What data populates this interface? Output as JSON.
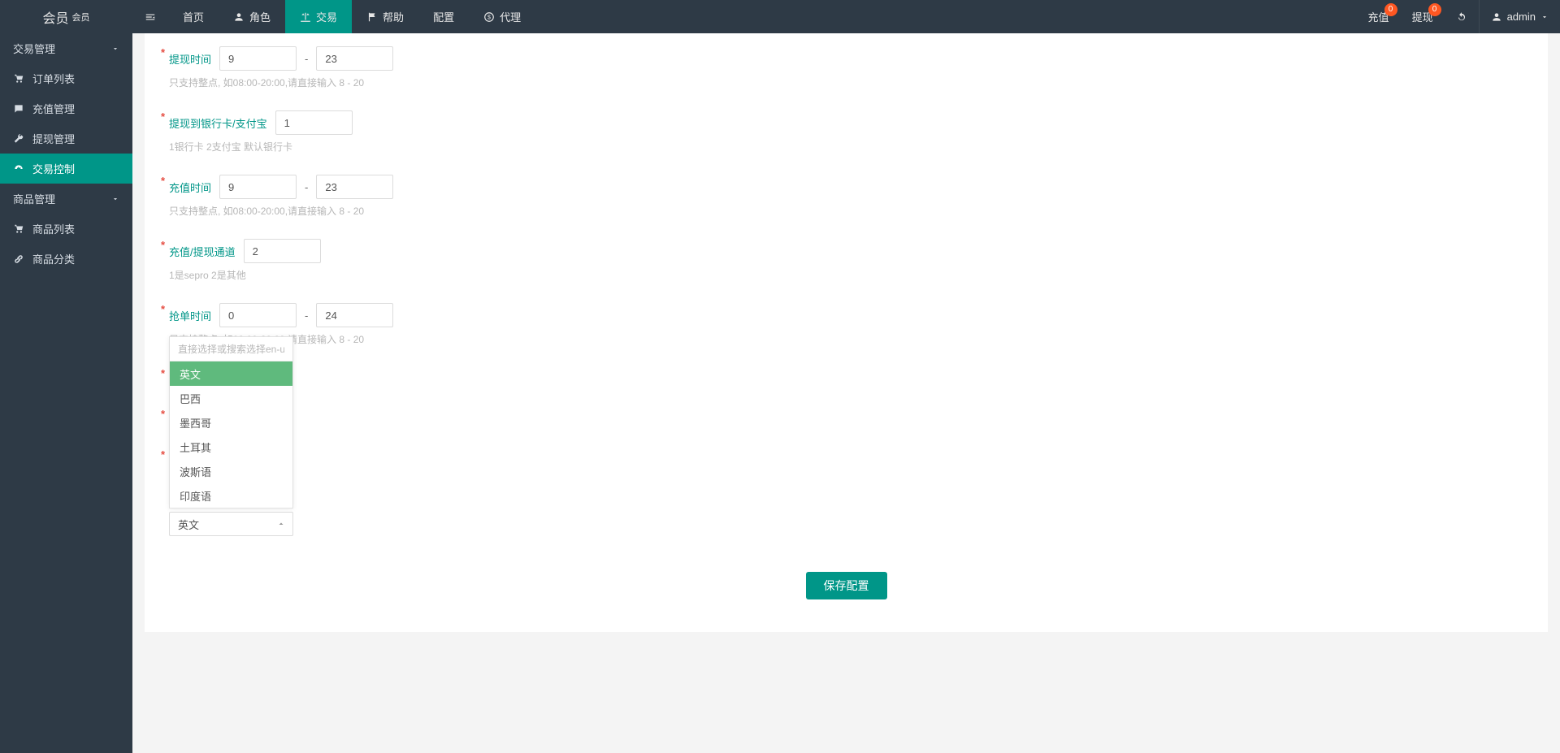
{
  "brand": {
    "title": "会员",
    "subtitle": "会员"
  },
  "nav": {
    "items": [
      {
        "label": "首页",
        "icon": "home"
      },
      {
        "label": "角色",
        "icon": "user"
      },
      {
        "label": "交易",
        "icon": "scale",
        "active": true
      },
      {
        "label": "帮助",
        "icon": "flag"
      },
      {
        "label": "配置",
        "icon": ""
      },
      {
        "label": "代理",
        "icon": "dollar"
      }
    ]
  },
  "header_right": {
    "recharge": {
      "label": "充值",
      "badge": "0"
    },
    "withdraw": {
      "label": "提现",
      "badge": "0"
    },
    "user": {
      "label": "admin"
    }
  },
  "sidebar": {
    "groups": [
      {
        "label": "交易管理",
        "open": true,
        "items": [
          {
            "label": "订单列表",
            "icon": "cart"
          },
          {
            "label": "充值管理",
            "icon": "comment"
          },
          {
            "label": "提现管理",
            "icon": "wrench"
          },
          {
            "label": "交易控制",
            "icon": "dashboard",
            "active": true
          }
        ]
      },
      {
        "label": "商品管理",
        "open": true,
        "items": [
          {
            "label": "商品列表",
            "icon": "cart"
          },
          {
            "label": "商品分类",
            "icon": "link"
          }
        ]
      }
    ]
  },
  "form": {
    "withdraw_time": {
      "label": "提现时间",
      "from": "9",
      "to": "23",
      "hint": "只支持整点, 如08:00-20:00,请直接输入 8 - 20"
    },
    "withdraw_to": {
      "label": "提现到银行卡/支付宝",
      "value": "1",
      "hint": "1银行卡 2支付宝 默认银行卡"
    },
    "recharge_time": {
      "label": "充值时间",
      "from": "9",
      "to": "23",
      "hint": "只支持整点, 如08:00-20:00,请直接输入 8 - 20"
    },
    "channel": {
      "label": "充值/提现通道",
      "value": "2",
      "hint": "1是sepro 2是其他"
    },
    "grab_time": {
      "label": "抢单时间",
      "from": "0",
      "to": "24",
      "hint": "只支持整点, 如08:00-20:00,请直接输入 8 - 20"
    },
    "lang": {
      "selected": "英文",
      "placeholder": "直接选择或搜索选择en-us",
      "options": [
        "英文",
        "巴西",
        "墨西哥",
        "土耳其",
        "波斯语",
        "印度语"
      ]
    },
    "save": "保存配置"
  }
}
